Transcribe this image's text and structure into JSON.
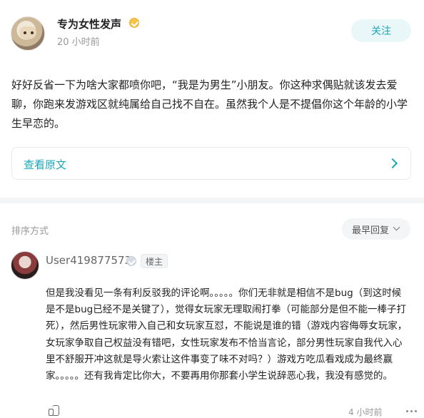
{
  "post": {
    "author": "专为女性发声",
    "time": "20 小时前",
    "follow_label": "关注",
    "content": "好好反省一下为啥大家都喷你吧，“我是为男生”小朋友。你这种求偶贴就该发去爱聊，你跑来发游戏区就纯属给自己找不自在。虽然我个人是不提倡你这个年龄的小学生早恋的。",
    "view_original_label": "查看原文"
  },
  "comments_section": {
    "sort_label": "排序方式",
    "sort_value": "最早回复",
    "items": [
      {
        "username": "User419877573",
        "tag": "楼主",
        "content": "但是我没看见一条有利反驳我的评论啊。。。。。你们无非就是相信不是bug（到这时候是不是bug已经不是关键了），觉得女玩家无理取闹打拳（可能部分是但不能一棒子打死），然后男性玩家带入自己和女玩家互怼，不能说是谁的错（游戏内容侮辱女玩家，女玩家争取自己权益没有错吧，女性玩家发布不恰当言论，部分男性玩家自我代入心里不舒服开冲这就是导火索让这件事变了味不对吗？）游戏方吃瓜看戏成为最终赢家。。。。。还有我肯定比你大，不要再用你那套小学生说辞恶心我，我没有感觉的。",
        "time": "4 小时前"
      }
    ]
  },
  "colors": {
    "accent": "#1aa7b8",
    "muted": "#999999",
    "divider": "#f4f5f7"
  },
  "icons": {
    "verified": "verified-badge-icon",
    "chevron_right": "chevron-right-icon",
    "chevron_down": "chevron-down-icon",
    "like": "thumb-up-icon",
    "more": "more-icon"
  }
}
